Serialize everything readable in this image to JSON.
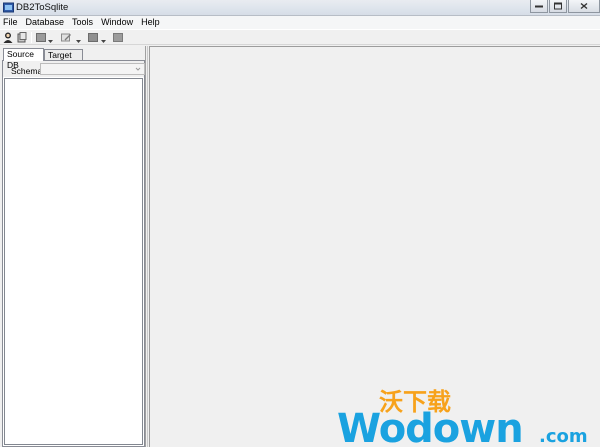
{
  "window": {
    "title": "DB2ToSqlite"
  },
  "menu": {
    "items": [
      "File",
      "Database",
      "Tools",
      "Window",
      "Help"
    ]
  },
  "toolbar": {
    "icons": [
      "user-connect-icon",
      "save-icon",
      "grid-icon",
      "dropdown-arrow-icon",
      "edit-icon",
      "dropdown-arrow-icon",
      "table-icon",
      "dropdown-arrow-icon",
      "stop-icon"
    ]
  },
  "left_panel": {
    "tabs": [
      "Source DB",
      "Target DB"
    ],
    "active_tab": "Source DB",
    "schema_label": "Schema",
    "schema_value": ""
  },
  "watermark": {
    "brand": "Wodown",
    "suffix": ".com",
    "cn": "沃下载"
  },
  "colors": {
    "watermark_blue": "#1aa2e0",
    "watermark_orange": "#f7a21b"
  }
}
